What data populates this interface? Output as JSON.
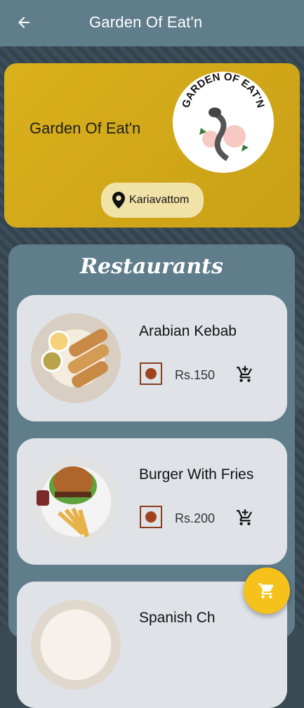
{
  "app_bar": {
    "title": "Garden Of Eat'n"
  },
  "hero": {
    "name": "Garden Of Eat'n",
    "logo_text": "GARDEN OF EAT'N",
    "location": "Kariavattom"
  },
  "section_title": "Restaurants",
  "items": [
    {
      "name": "Arabian Kebab",
      "price": "Rs.150"
    },
    {
      "name": "Burger With Fries",
      "price": "Rs.200"
    },
    {
      "name": "Spanish Ch"
    }
  ],
  "colors": {
    "app_bar": "#607d8b",
    "hero": "#d9b01c",
    "fab": "#f6c11b",
    "card": "#dfe3e8"
  }
}
